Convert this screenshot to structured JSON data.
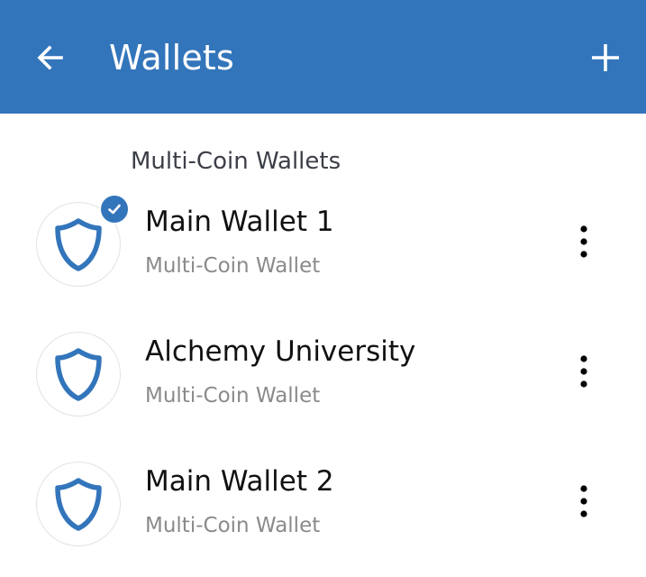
{
  "appbar": {
    "title": "Wallets",
    "back_icon": "arrow-left-icon",
    "add_icon": "plus-icon",
    "background_color": "#3375bb"
  },
  "section": {
    "label": "Multi-Coin Wallets"
  },
  "wallets": [
    {
      "name": "Main Wallet 1",
      "type": "Multi-Coin Wallet",
      "selected": true
    },
    {
      "name": "Alchemy University",
      "type": "Multi-Coin Wallet",
      "selected": false
    },
    {
      "name": "Main Wallet 2",
      "type": "Multi-Coin Wallet",
      "selected": false
    }
  ],
  "icons": {
    "wallet_avatar": "shield-icon",
    "selected_badge": "check-badge-icon",
    "row_menu": "more-vertical-icon"
  },
  "colors": {
    "accent": "#3375bb",
    "primary_text": "#111111",
    "secondary_text": "#8a8a8a"
  }
}
